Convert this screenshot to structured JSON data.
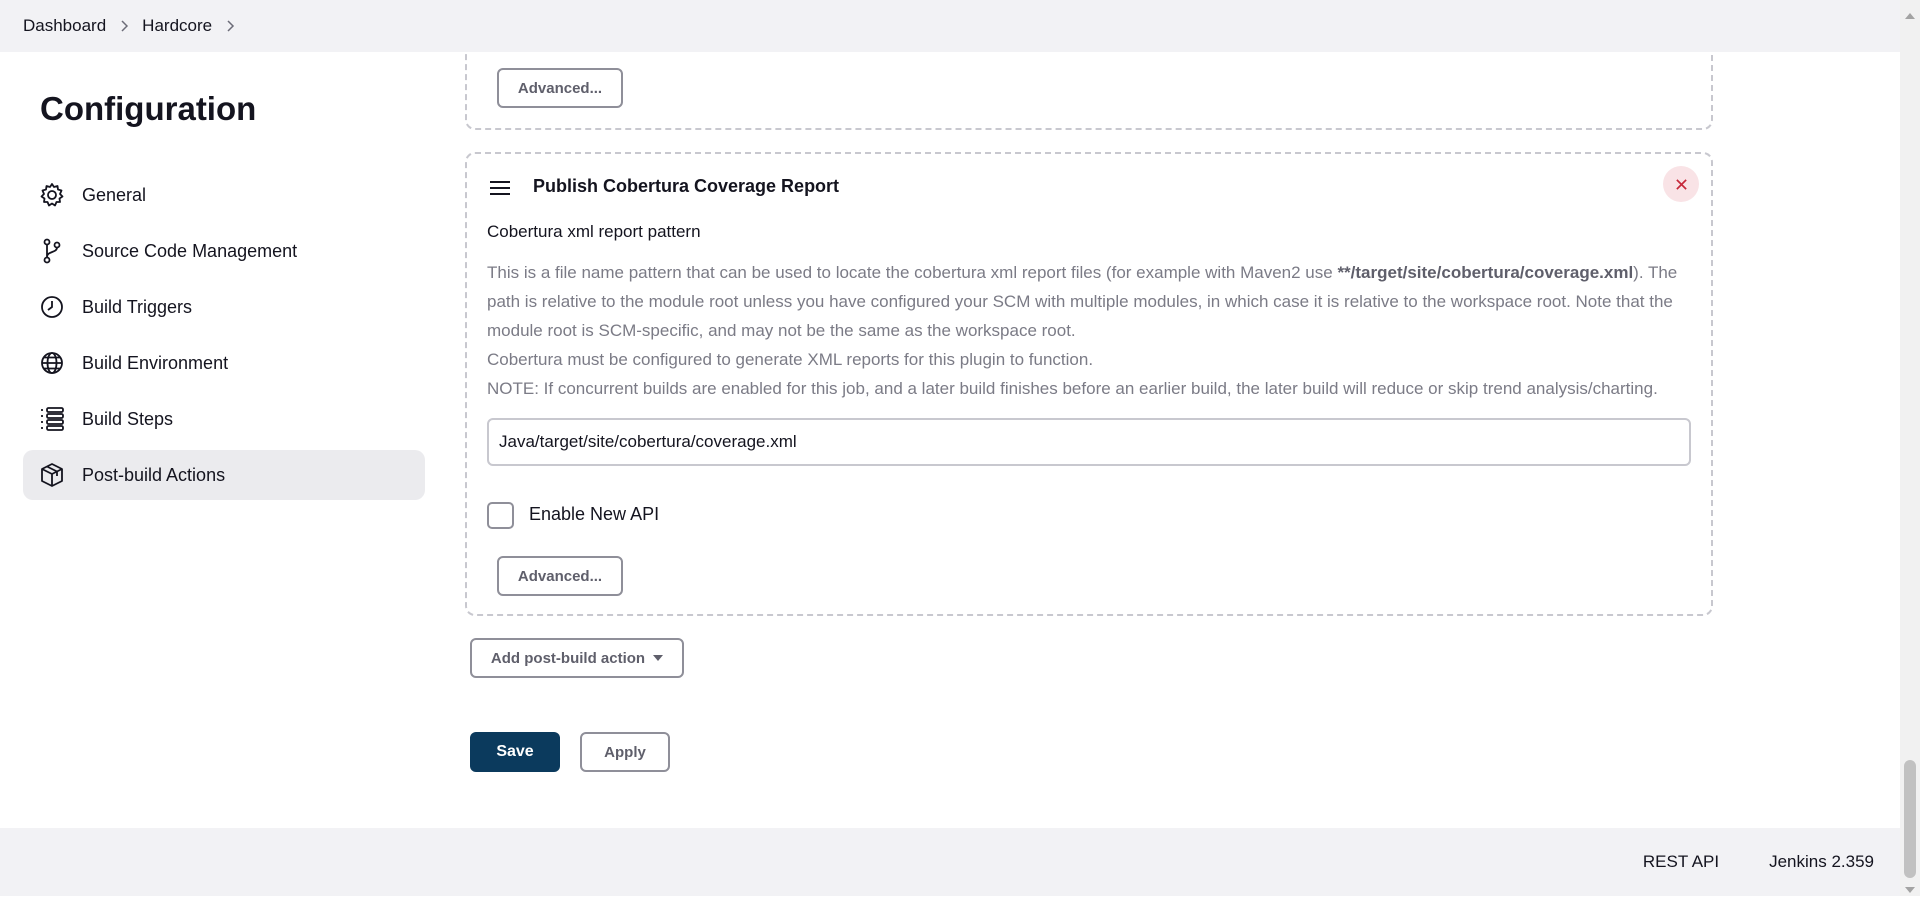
{
  "breadcrumb": {
    "items": [
      "Dashboard",
      "Hardcore"
    ]
  },
  "sidebar": {
    "title": "Configuration",
    "items": [
      {
        "label": "General",
        "icon": "gear-icon",
        "active": false
      },
      {
        "label": "Source Code Management",
        "icon": "branch-icon",
        "active": false
      },
      {
        "label": "Build Triggers",
        "icon": "clock-icon",
        "active": false
      },
      {
        "label": "Build Environment",
        "icon": "globe-icon",
        "active": false
      },
      {
        "label": "Build Steps",
        "icon": "list-icon",
        "active": false
      },
      {
        "label": "Post-build Actions",
        "icon": "package-icon",
        "active": true
      }
    ]
  },
  "previous_section": {
    "advanced_label": "Advanced..."
  },
  "cobertura": {
    "title": "Publish Cobertura Coverage Report",
    "field_label": "Cobertura xml report pattern",
    "help_intro": "This is a file name pattern that can be used to locate the cobertura xml report files (for example with Maven2 use ",
    "help_example": "**/target/site/cobertura/coverage.xml",
    "help_rest": "). The path is relative to the module root unless you have configured your SCM with multiple modules, in which case it is relative to the workspace root. Note that the module root is SCM-specific, and may not be the same as the workspace root.",
    "help_line2": "Cobertura must be configured to generate XML reports for this plugin to function.",
    "help_line3": "NOTE: If concurrent builds are enabled for this job, and a later build finishes before an earlier build, the later build will reduce or skip trend analysis/charting.",
    "pattern_value": "Java/target/site/cobertura/coverage.xml",
    "enable_api_label": "Enable New API",
    "enable_api_checked": false,
    "advanced_label": "Advanced..."
  },
  "actions": {
    "add_post_build": "Add post-build action",
    "save": "Save",
    "apply": "Apply"
  },
  "footer": {
    "rest_api": "REST API",
    "version": "Jenkins 2.359"
  },
  "colors": {
    "save_bg": "#0b3a5d",
    "close_bg": "#f9e3e6",
    "close_fg": "#c6283a",
    "active_nav_bg": "#ebebee"
  }
}
